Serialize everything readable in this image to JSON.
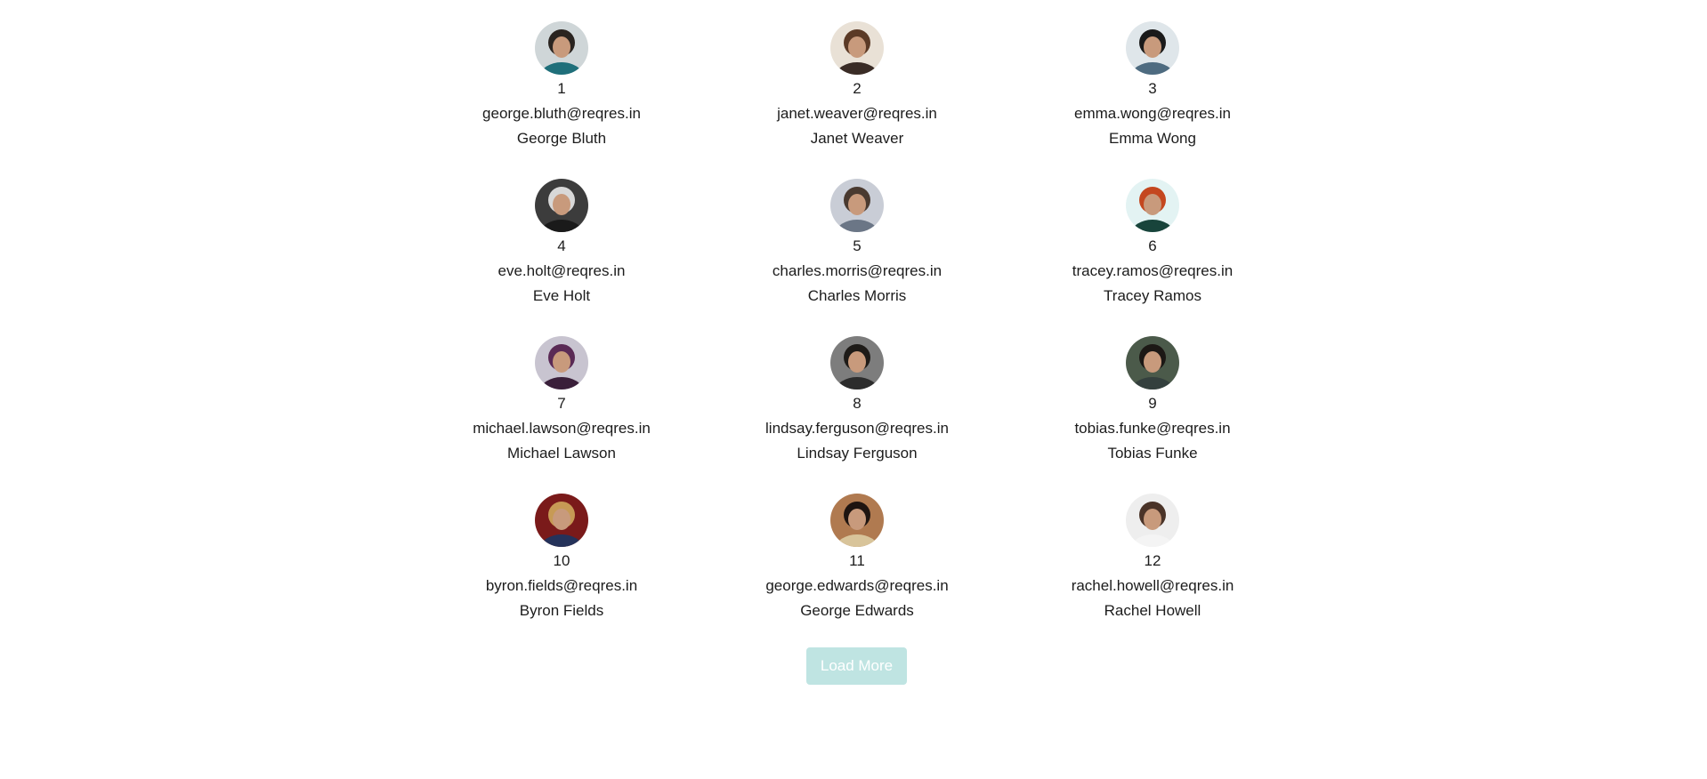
{
  "users": [
    {
      "id": "1",
      "email": "george.bluth@reqres.in",
      "name": "George Bluth",
      "avatar_bg": "#cfd6d8",
      "avatar_fg": "#2a2420",
      "avatar_shirt": "#1f6f7a"
    },
    {
      "id": "2",
      "email": "janet.weaver@reqres.in",
      "name": "Janet Weaver",
      "avatar_bg": "#e9e1d6",
      "avatar_fg": "#5b3a26",
      "avatar_shirt": "#3a2c26"
    },
    {
      "id": "3",
      "email": "emma.wong@reqres.in",
      "name": "Emma Wong",
      "avatar_bg": "#dfe6ea",
      "avatar_fg": "#1a1a1a",
      "avatar_shirt": "#4e6b80"
    },
    {
      "id": "4",
      "email": "eve.holt@reqres.in",
      "name": "Eve Holt",
      "avatar_bg": "#3c3c3c",
      "avatar_fg": "#d8d8d8",
      "avatar_shirt": "#1a1a1a"
    },
    {
      "id": "5",
      "email": "charles.morris@reqres.in",
      "name": "Charles Morris",
      "avatar_bg": "#c9cdd6",
      "avatar_fg": "#4a3a30",
      "avatar_shirt": "#6b7686"
    },
    {
      "id": "6",
      "email": "tracey.ramos@reqres.in",
      "name": "Tracey Ramos",
      "avatar_bg": "#e3f3f3",
      "avatar_fg": "#c4471f",
      "avatar_shirt": "#18443b"
    },
    {
      "id": "7",
      "email": "michael.lawson@reqres.in",
      "name": "Michael Lawson",
      "avatar_bg": "#c8c4d0",
      "avatar_fg": "#5a2a55",
      "avatar_shirt": "#3a1f3a"
    },
    {
      "id": "8",
      "email": "lindsay.ferguson@reqres.in",
      "name": "Lindsay Ferguson",
      "avatar_bg": "#7d7d7d",
      "avatar_fg": "#1e1b18",
      "avatar_shirt": "#2c2c2c"
    },
    {
      "id": "9",
      "email": "tobias.funke@reqres.in",
      "name": "Tobias Funke",
      "avatar_bg": "#4b5a4a",
      "avatar_fg": "#1c1815",
      "avatar_shirt": "#34403e"
    },
    {
      "id": "10",
      "email": "byron.fields@reqres.in",
      "name": "Byron Fields",
      "avatar_bg": "#7a1a1a",
      "avatar_fg": "#c79a55",
      "avatar_shirt": "#24325a"
    },
    {
      "id": "11",
      "email": "george.edwards@reqres.in",
      "name": "George Edwards",
      "avatar_bg": "#b07a50",
      "avatar_fg": "#1e1410",
      "avatar_shirt": "#d8c49a"
    },
    {
      "id": "12",
      "email": "rachel.howell@reqres.in",
      "name": "Rachel Howell",
      "avatar_bg": "#eeeeee",
      "avatar_fg": "#4a3328",
      "avatar_shirt": "#f4f4f4"
    }
  ],
  "load_more_label": "Load More",
  "colors": {
    "load_more_bg": "#bfe4e2",
    "load_more_text": "#ffffff",
    "text": "#1c1c1c"
  }
}
